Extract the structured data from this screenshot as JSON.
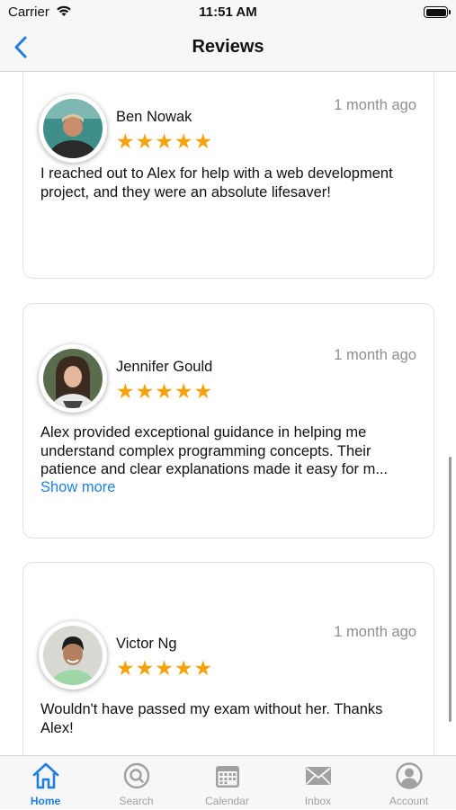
{
  "status_bar": {
    "carrier": "Carrier",
    "time": "11:51 AM"
  },
  "nav": {
    "title": "Reviews"
  },
  "reviews": [
    {
      "name": "Ben Nowak",
      "stars": "★★★★★",
      "rating": 5,
      "date": "1 month ago",
      "text": "I reached out to Alex for help with a web development project, and they were an absolute lifesaver!"
    },
    {
      "name": "Jennifer Gould",
      "stars": "★★★★★",
      "rating": 5,
      "date": "1 month ago",
      "text": "Alex provided exceptional guidance in helping me understand complex programming concepts. Their patience and clear explanations made it easy for m...",
      "more_label": "Show more"
    },
    {
      "name": "Victor Ng",
      "stars": "★★★★★",
      "rating": 5,
      "date": "1 month ago",
      "text": "Wouldn't have passed my exam without her. Thanks Alex!"
    }
  ],
  "tabs": [
    {
      "label": "Home",
      "icon": "home-icon",
      "active": true
    },
    {
      "label": "Search",
      "icon": "search-icon",
      "active": false
    },
    {
      "label": "Calendar",
      "icon": "calendar-icon",
      "active": false
    },
    {
      "label": "Inbox",
      "icon": "inbox-icon",
      "active": false
    },
    {
      "label": "Account",
      "icon": "account-icon",
      "active": false
    }
  ],
  "colors": {
    "accent": "#1f7fe0",
    "star": "#f5a20b",
    "muted": "#8e8e93",
    "inactive_tab": "#a0a0a0"
  }
}
